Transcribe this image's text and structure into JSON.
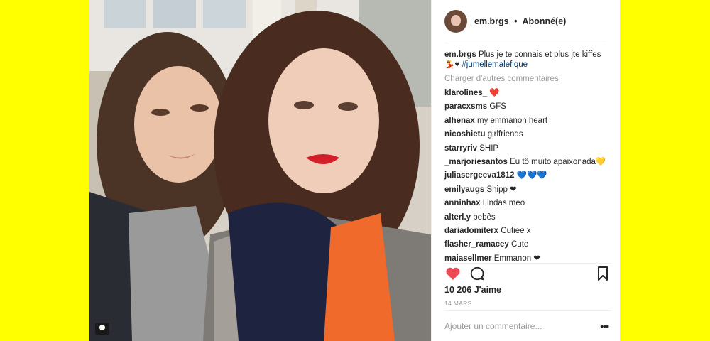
{
  "header": {
    "username": "em.brgs",
    "separator": "•",
    "follow_status": "Abonné(e)"
  },
  "caption": {
    "username": "em.brgs",
    "text": "Plus je te connais et plus jte kiffes",
    "emoji": "💃♥",
    "hashtag": "#jumellemalefique"
  },
  "load_more_label": "Charger d'autres commentaires",
  "comments": [
    {
      "user": "klarolines_",
      "text": "❤️"
    },
    {
      "user": "paracxsms",
      "text": "GFS"
    },
    {
      "user": "alhenax",
      "text": "my emmanon heart"
    },
    {
      "user": "nicoshietu",
      "text": "girlfriends"
    },
    {
      "user": "starryriv",
      "text": "SHIP"
    },
    {
      "user": "_marjoriesantos",
      "text": "Eu tô muito apaixonada💛"
    },
    {
      "user": "juliasergeeva1812",
      "text": "💙💙💙"
    },
    {
      "user": "emilyaugs",
      "text": "Shipp ❤"
    },
    {
      "user": "anninhax",
      "text": "Lindas meo"
    },
    {
      "user": "alterl.y",
      "text": "bebês"
    },
    {
      "user": "dariadomiterx",
      "text": "Cutiee x"
    },
    {
      "user": "flasher_ramacey",
      "text": "Cute"
    },
    {
      "user": "maiasellmer",
      "text": "Emmanon ❤"
    }
  ],
  "actions": {
    "like_icon": "heart-filled-icon",
    "comment_icon": "comment-bubble-icon",
    "save_icon": "bookmark-icon",
    "like_color": "#ed4956"
  },
  "likes_text": "10 206 J'aime",
  "date_text": "14 MARS",
  "add_comment": {
    "placeholder": "Ajouter un commentaire...",
    "more_label": "•••"
  },
  "colors": {
    "background": "#ffff00",
    "panel": "#ffffff",
    "hashtag": "#003569",
    "muted": "#999999"
  }
}
